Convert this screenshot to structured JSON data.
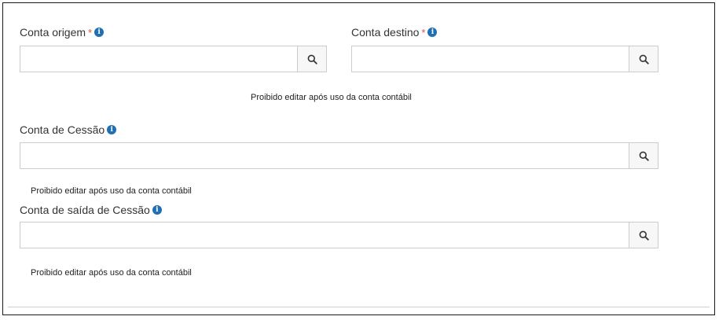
{
  "form": {
    "conta_origem": {
      "label": "Conta origem",
      "required_mark": "*",
      "value": "",
      "icon": "info-circle-icon",
      "search_icon": "search-icon"
    },
    "conta_destino": {
      "label": "Conta destino",
      "required_mark": "*",
      "value": "",
      "icon": "info-circle-icon",
      "search_icon": "search-icon"
    },
    "help_origem_destino": "Proibido editar após uso da conta contábil",
    "conta_cessao": {
      "label": "Conta de Cessão",
      "value": "",
      "icon": "info-circle-icon",
      "search_icon": "search-icon",
      "help": "Proibido editar após uso da conta contábil"
    },
    "conta_saida_cessao": {
      "label": "Conta de saída de Cessão",
      "value": "",
      "icon": "info-circle-icon",
      "search_icon": "search-icon",
      "help": "Proibido editar após uso da conta contábil"
    }
  },
  "colors": {
    "required": "#e0523c",
    "info_icon": "#1f6fb2",
    "border": "#cccccc"
  }
}
